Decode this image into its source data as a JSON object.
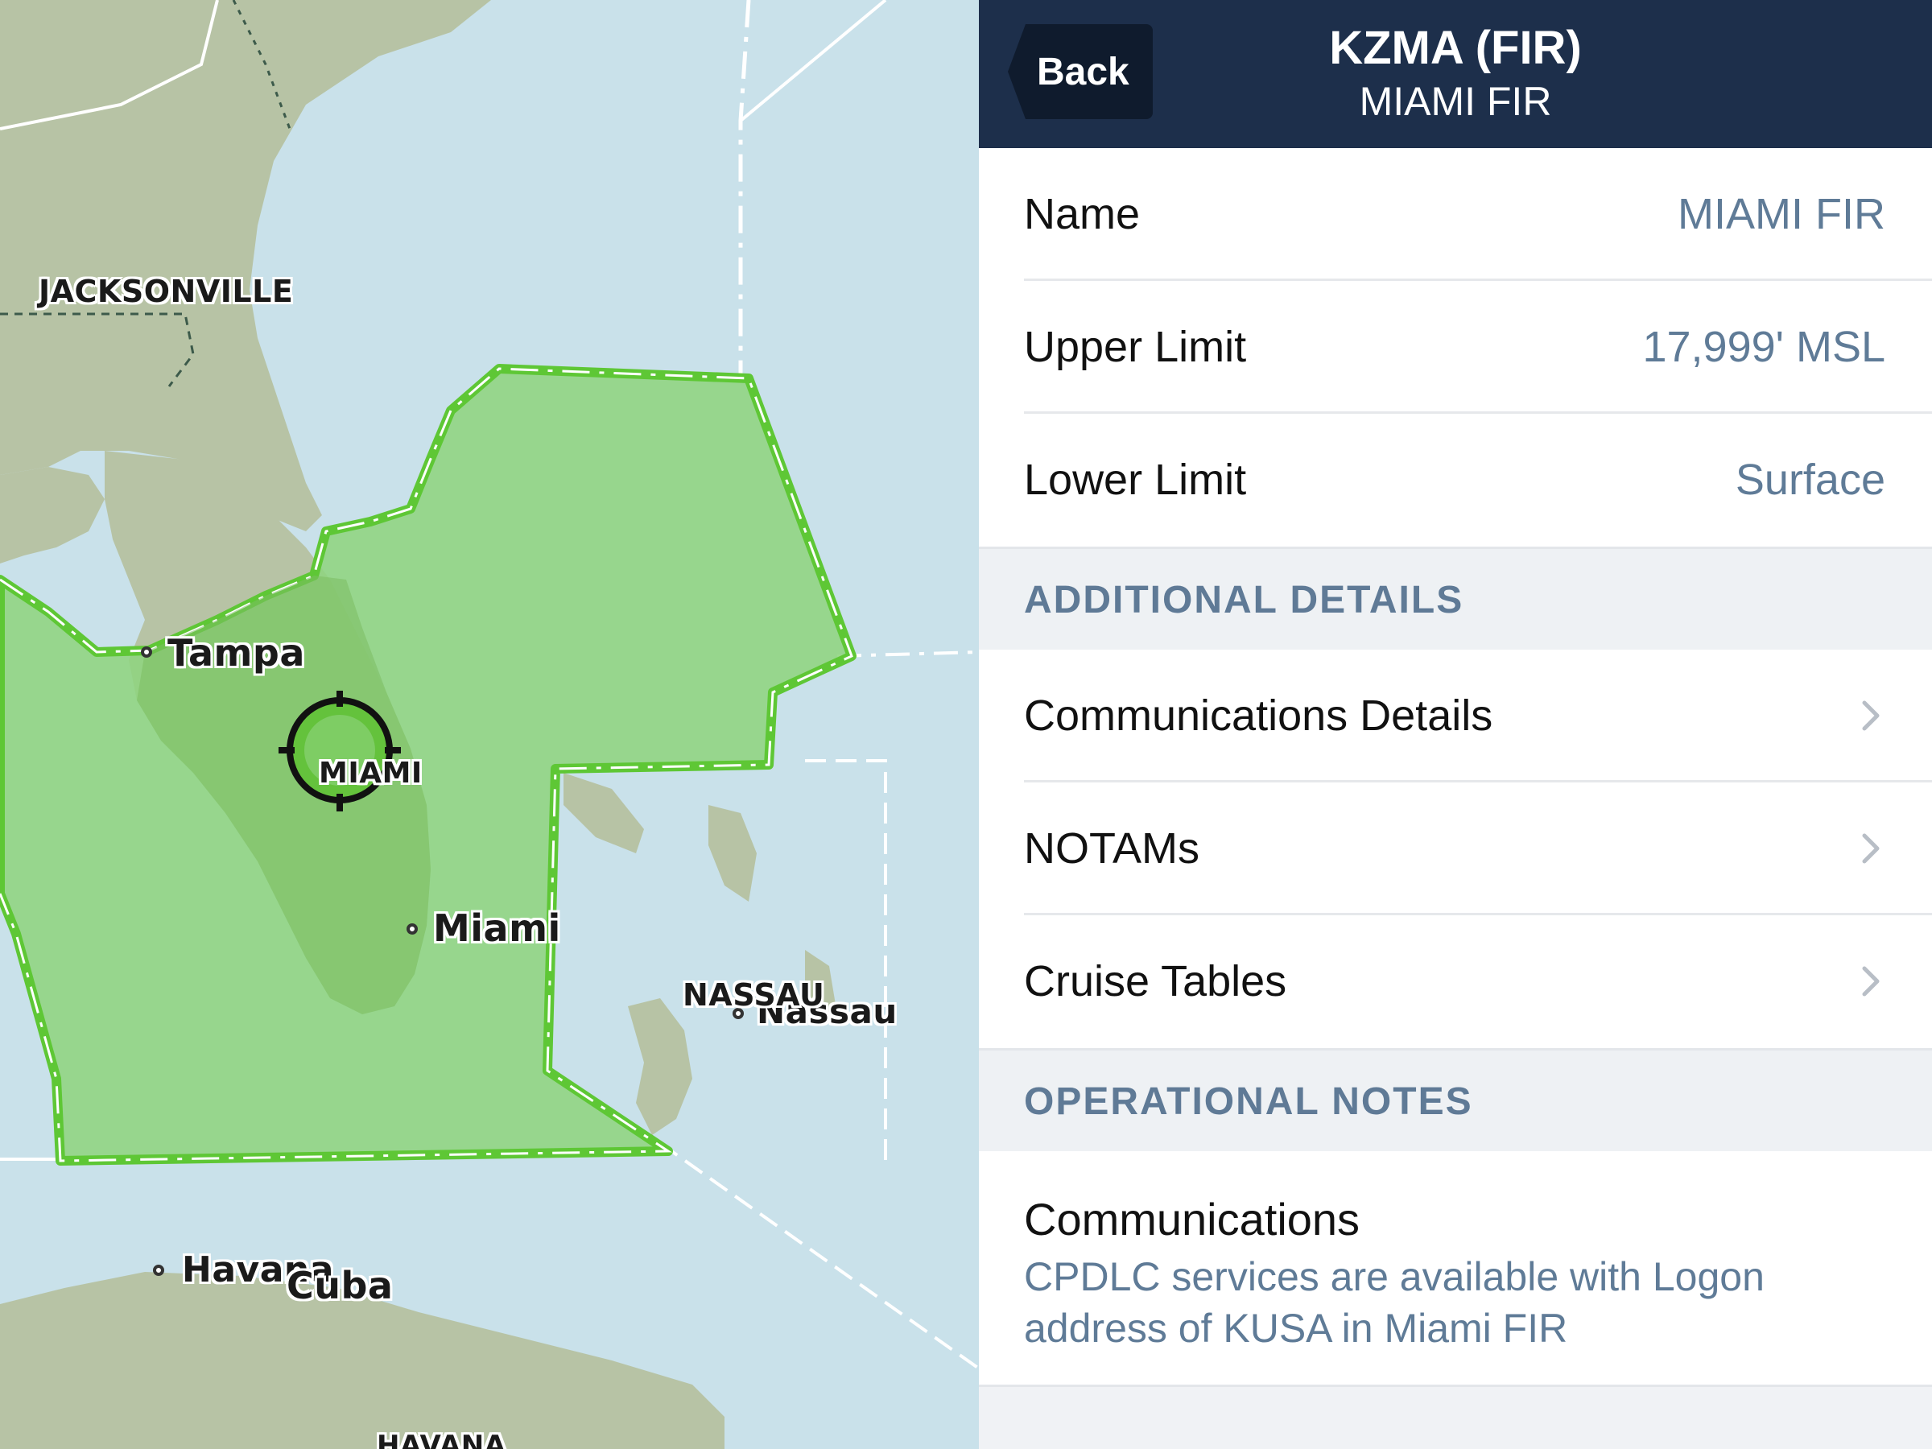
{
  "map": {
    "labels": {
      "jacksonville": "JACKSONVILLE",
      "tampa": "Tampa",
      "miami_region": "MIAMI",
      "miami_city": "Miami",
      "nassau_upper": "NASSAU",
      "nassau_city": "Nassau",
      "havana": "Havana",
      "cuba": "Cuba",
      "havana_upper": "HAVANA"
    },
    "colors": {
      "water": "#c9e1ea",
      "land": "#b7c3a5",
      "fir_fill": "#8fd47f",
      "fir_border": "#5ec735"
    },
    "icons": {
      "center_marker": "target-crosshair-icon"
    }
  },
  "navbar": {
    "back_label": "Back",
    "title": "KZMA (FIR)",
    "subtitle": "MIAMI FIR"
  },
  "details": {
    "name_label": "Name",
    "name_value": "MIAMI FIR",
    "upper_label": "Upper Limit",
    "upper_value": "17,999' MSL",
    "lower_label": "Lower Limit",
    "lower_value": "Surface"
  },
  "additional": {
    "header": "ADDITIONAL DETAILS",
    "items": [
      "Communications Details",
      "NOTAMs",
      "Cruise Tables"
    ]
  },
  "operational": {
    "header": "OPERATIONAL NOTES",
    "note_title": "Communications",
    "note_text": "CPDLC services are available with Logon address of KUSA in Miami FIR"
  },
  "colors": {
    "navbar_bg": "#1d2f4b",
    "value_text": "#5f7b97",
    "section_bg": "#eef1f4"
  }
}
